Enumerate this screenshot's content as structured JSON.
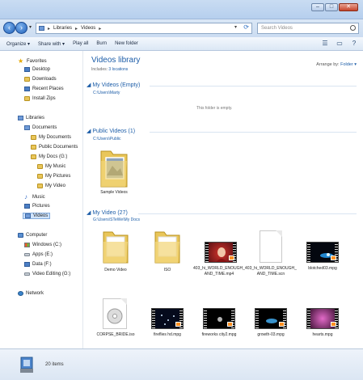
{
  "window": {
    "minimize": "–",
    "maximize": "□",
    "close": "✕"
  },
  "address": {
    "crumbs": [
      "Libraries",
      "Videos"
    ],
    "search_placeholder": "Search Videos"
  },
  "toolbar": {
    "items": [
      "Organize ▾",
      "Share with ▾",
      "Play all",
      "Burn",
      "New folder"
    ]
  },
  "sidebar": {
    "favorites": {
      "label": "Favorites",
      "items": [
        "Desktop",
        "Downloads",
        "Recent Places",
        "Install Zips"
      ]
    },
    "libraries": {
      "label": "Libraries",
      "documents": "Documents",
      "doc_children": [
        "My Documents",
        "Public Documents",
        "My Docs (G:)"
      ],
      "mydocs_children": [
        "My Music",
        "My Pictures",
        "My Video"
      ],
      "others": [
        "Music",
        "Pictures",
        "Videos"
      ]
    },
    "computer": {
      "label": "Computer",
      "items": [
        "Windows (C:)",
        "Apps (E:)",
        "Data (F:)",
        "Video Editing (G:)"
      ]
    },
    "network": "Network"
  },
  "main": {
    "title": "Videos library",
    "includes_prefix": "Includes:",
    "includes_link": "3 locations",
    "arrange_label": "Arrange by:",
    "arrange_value": "Folder ▾",
    "groups": [
      {
        "header": "My Videos (Empty)",
        "path": "C:\\Users\\Marty",
        "empty_message": "This folder is empty."
      },
      {
        "header": "Public Videos (1)",
        "path": "C:\\Users\\Public",
        "items": [
          "Sample Videos"
        ]
      },
      {
        "header": "My Video (27)",
        "path": "G:\\Users\\STeWe\\My Docs",
        "items": [
          "Demo Video",
          "ISO",
          "403_hi_WORLD_ENOUGH_AND_TIME.mp4",
          "403_hi_WORLD_ENOUGH_AND_TIME.scn",
          "blotched03.mpg",
          "CORPSE_BRIDE.iso",
          "fireflies hd.mpg",
          "fireworks city2.mpg",
          "growth-03.mpg",
          "hearts.mpg"
        ]
      }
    ]
  },
  "status": {
    "count": "20 items"
  },
  "colors": {
    "accent": "#1c5da8",
    "folder": "#e9c65a",
    "playtag": "#ff8f22"
  }
}
